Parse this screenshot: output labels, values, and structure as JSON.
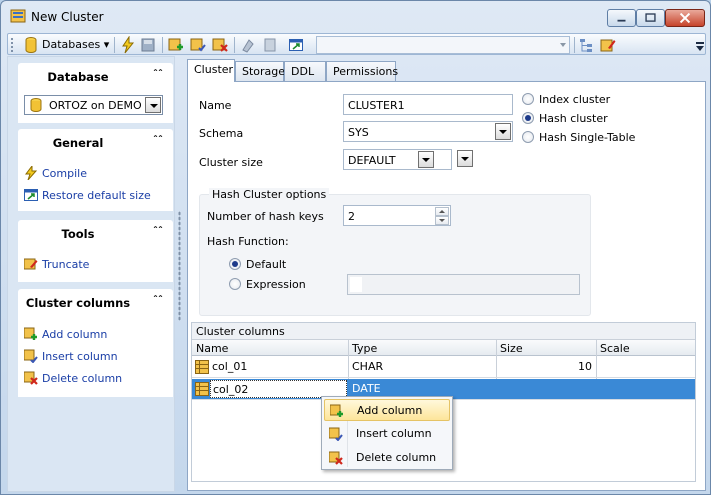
{
  "window": {
    "title": "New Cluster"
  },
  "toolbar": {
    "database_label": "Databases",
    "combo_value": ""
  },
  "sidebar": {
    "database": {
      "header": "Database",
      "selected_db": "ORTOZ on DEMO"
    },
    "general": {
      "header": "General",
      "items": [
        {
          "label": "Compile"
        },
        {
          "label": "Restore default size"
        }
      ]
    },
    "tools": {
      "header": "Tools",
      "items": [
        {
          "label": "Truncate"
        }
      ]
    },
    "cluster_columns": {
      "header": "Cluster columns",
      "items": [
        {
          "label": "Add column"
        },
        {
          "label": "Insert column"
        },
        {
          "label": "Delete column"
        }
      ]
    }
  },
  "tabs": [
    {
      "label": "Cluster",
      "active": true
    },
    {
      "label": "Storage",
      "active": false
    },
    {
      "label": "DDL",
      "active": false
    },
    {
      "label": "Permissions",
      "active": false
    }
  ],
  "form": {
    "name_label": "Name",
    "name_value": "CLUSTER1",
    "schema_label": "Schema",
    "schema_value": "SYS",
    "size_label": "Cluster size",
    "size_value": "DEFAULT",
    "cluster_type": {
      "options": [
        "Index cluster",
        "Hash cluster",
        "Hash Single-Table"
      ],
      "selected": "Hash cluster"
    },
    "hash_options": {
      "title": "Hash Cluster options",
      "keys_label": "Number of hash keys",
      "keys_value": "2",
      "function_label": "Hash Function:",
      "function_options": [
        "Default",
        "Expression"
      ],
      "function_selected": "Default",
      "expression_value": ""
    }
  },
  "grid": {
    "caption": "Cluster columns",
    "columns": [
      "Name",
      "Type",
      "Size",
      "Scale"
    ],
    "rows": [
      {
        "name": "col_01",
        "type": "CHAR",
        "size": "10",
        "scale": "",
        "selected": false
      },
      {
        "name": "col_02",
        "type": "DATE",
        "size": "",
        "scale": "",
        "selected": true
      }
    ]
  },
  "context_menu": {
    "items": [
      {
        "label": "Add column",
        "highlighted": true
      },
      {
        "label": "Insert column",
        "highlighted": false
      },
      {
        "label": "Delete column",
        "highlighted": false
      }
    ]
  },
  "colors": {
    "accent": "#3a89d6",
    "link": "#1a3ea6",
    "highlight": "#fde59a"
  }
}
